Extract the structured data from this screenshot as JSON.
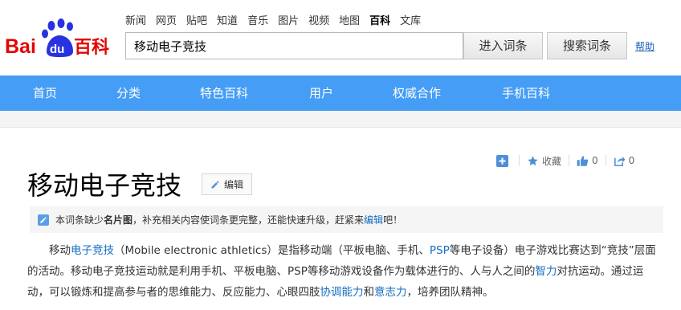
{
  "logo": {
    "alt": "Baidu 百科",
    "bai": "Bai",
    "du": "du",
    "baike": "百科",
    "brand_red": "#e10601",
    "brand_blue": "#2932e1"
  },
  "top_nav": [
    "新闻",
    "网页",
    "贴吧",
    "知道",
    "音乐",
    "图片",
    "视频",
    "地图",
    "百科",
    "文库"
  ],
  "top_nav_active": "百科",
  "search": {
    "value": "移动电子竞技",
    "enter_label": "进入词条",
    "search_label": "搜索词条",
    "help": "帮助"
  },
  "main_nav": [
    "首页",
    "分类",
    "特色百科",
    "用户",
    "权威合作",
    "手机百科"
  ],
  "accent": "#459df5",
  "link_color": "#136ec2",
  "actions": {
    "add_icon": "plus-square-icon",
    "favorite_icon": "star-icon",
    "favorite_label": "收藏",
    "like_icon": "thumbs-up-icon",
    "like_count": "0",
    "share_icon": "share-icon",
    "share_count": "0"
  },
  "title": "移动电子竞技",
  "edit_label": "编辑",
  "notice": {
    "icon": "pencil-icon",
    "part1": "本词条缺少",
    "bold": "名片图",
    "part2": "，补充相关内容使词条更完整，还能快速升级，赶紧来",
    "link": "编辑",
    "part3": "吧！"
  },
  "paragraph": {
    "t1": "移动",
    "l1": "电子竞技",
    "t2": "（Mobile electronic athletics）是指移动端（平板电脑、手机、",
    "l2": "PSP",
    "t3": "等电子设备）电子游戏比赛达到“竞技”层面的活动。移动电子竞技运动就是利用手机、平板电脑、PSP等移动游戏设备作为载体进行的、人与人之间的",
    "l3": "智力",
    "t4": "对抗运动。通过运动，可以锻炼和提高参与者的思维能力、反应能力、心眼四肢",
    "l4": "协调能力",
    "t5": "和",
    "l5": "意志力",
    "t6": "，培养团队精神。"
  }
}
